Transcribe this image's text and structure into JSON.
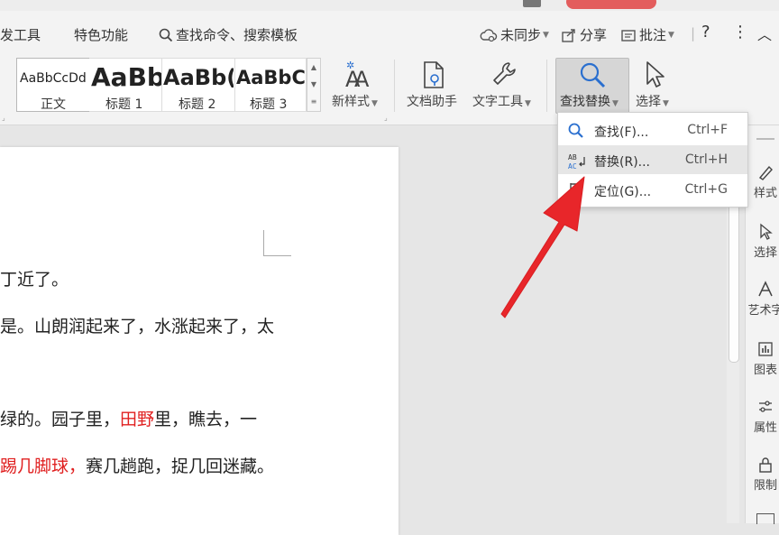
{
  "menubar": {
    "dev_tools": "发工具",
    "special": "特色功能",
    "search": "查找命令、搜索模板",
    "sync": "未同步",
    "share": "分享",
    "comment": "批注",
    "help": "?",
    "more": "⋮",
    "collapse": "︿"
  },
  "ribbon": {
    "styles": [
      {
        "sample": "AaBbCcDd",
        "label": "正文"
      },
      {
        "sample": "AaBb",
        "label": "标题 1"
      },
      {
        "sample": "AaBb(",
        "label": "标题 2"
      },
      {
        "sample": "AaBbC(",
        "label": "标题 3"
      }
    ],
    "new_style": "新样式",
    "doc_helper": "文档助手",
    "text_tools": "文字工具",
    "find_replace": "查找替换",
    "select": "选择"
  },
  "dropdown": {
    "items": [
      {
        "label": "查找(F)...",
        "shortcut": "Ctrl+F"
      },
      {
        "label": "替换(R)...",
        "shortcut": "Ctrl+H"
      },
      {
        "label": "定位(G)...",
        "shortcut": "Ctrl+G"
      }
    ]
  },
  "document": {
    "line1": "丁近了。",
    "line2": "是。山朗润起来了，水涨起来了，太",
    "line3a": "绿的。园子里，",
    "line3b": "田野",
    "line3c": "里，瞧去，一",
    "line4a": "踢几脚球，",
    "line4b": "赛几趟跑，捉几回迷藏。"
  },
  "sidepanel": {
    "items": [
      "样式",
      "选择",
      "艺术字",
      "图表",
      "属性",
      "限制"
    ]
  },
  "colors": {
    "accent_red": "#e02020",
    "arrow_red": "#e8262a"
  }
}
